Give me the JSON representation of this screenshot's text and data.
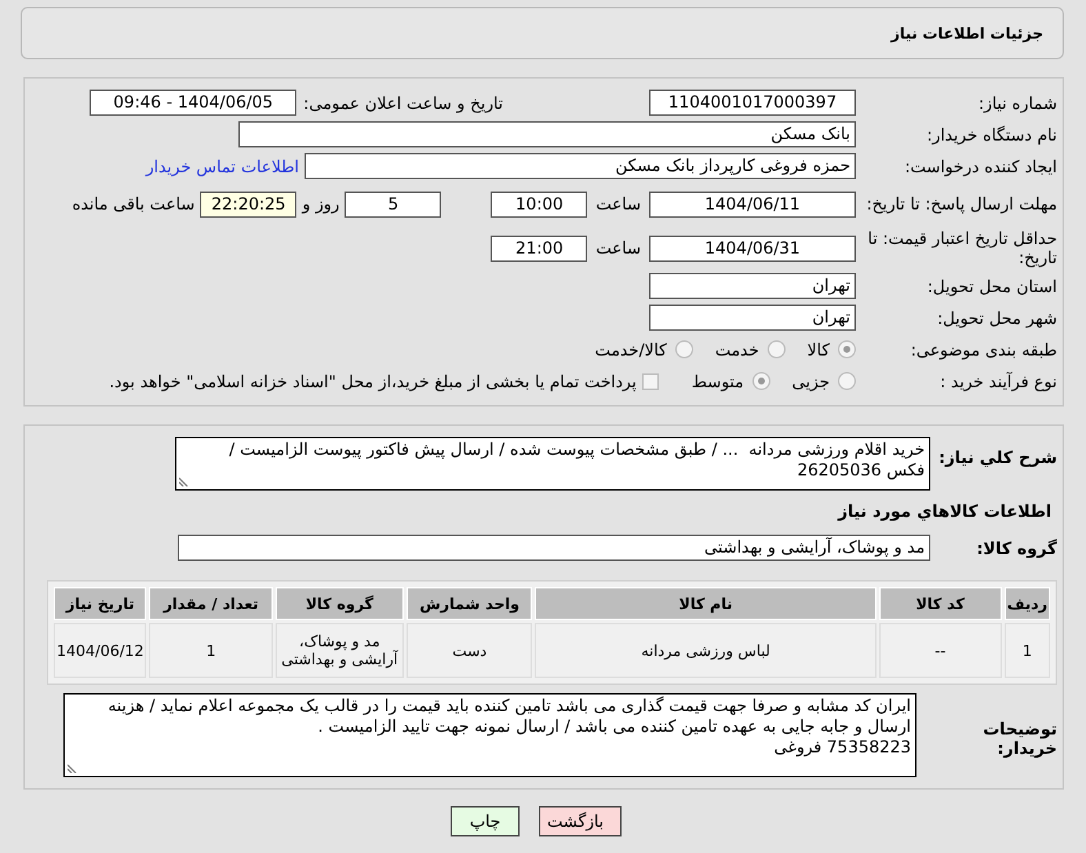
{
  "header": {
    "title": "جزئیات اطلاعات نیاز"
  },
  "need_number": {
    "label": "شماره نیاز:",
    "value": "1104001017000397"
  },
  "announce_date": {
    "label": "تاریخ و ساعت اعلان عمومی:",
    "value": "1404/06/05 - 09:46"
  },
  "buyer_org": {
    "label": "نام دستگاه خریدار:",
    "value": "بانک مسکن"
  },
  "requester": {
    "label": "ایجاد کننده درخواست:",
    "value": "حمزه فروغی کارپرداز بانک مسکن",
    "contact_link": "اطلاعات تماس خریدار"
  },
  "reply_deadline": {
    "label": "مهلت ارسال پاسخ: تا تاریخ:",
    "date": "1404/06/11",
    "time_label": "ساعت",
    "time": "10:00",
    "days": "5",
    "days_label": "روز و",
    "remaining": "22:20:25",
    "remaining_label": "ساعت باقی مانده"
  },
  "price_validity": {
    "label": "حداقل تاریخ اعتبار قیمت: تا تاریخ:",
    "date": "1404/06/31",
    "time_label": "ساعت",
    "time": "21:00"
  },
  "province": {
    "label": "استان محل تحویل:",
    "value": "تهران"
  },
  "city": {
    "label": "شهر محل تحویل:",
    "value": "تهران"
  },
  "category": {
    "label": "طبقه بندی موضوعی:",
    "options": [
      {
        "label": "کالا",
        "selected": true
      },
      {
        "label": "خدمت",
        "selected": false
      },
      {
        "label": "کالا/خدمت",
        "selected": false
      }
    ]
  },
  "process": {
    "label": "نوع فرآیند خرید :",
    "options": [
      {
        "label": "جزیی",
        "selected": false
      },
      {
        "label": "متوسط",
        "selected": true
      }
    ],
    "payment_note": {
      "text": "پرداخت تمام یا بخشی از مبلغ خرید،از محل \"اسناد خزانه اسلامی\" خواهد بود.",
      "checked": false
    }
  },
  "description": {
    "label": "شرح کلي نیاز:",
    "value": "خرید اقلام ورزشی مردانه  ... / طبق مشخصات پیوست شده / ارسال پیش فاکتور پیوست الزامیست / فکس 26205036"
  },
  "items_heading": "اطلاعات کالاهاي مورد نیاز",
  "goods_group": {
    "label": "گروه کالا:",
    "value": "مد و پوشاک، آرایشی و بهداشتی"
  },
  "table": {
    "columns": [
      "ردیف",
      "کد کالا",
      "نام کالا",
      "واحد شمارش",
      "گروه کالا",
      "تعداد / مقدار",
      "تاریخ نیاز"
    ],
    "rows": [
      [
        "1",
        "--",
        "لباس ورزشی مردانه",
        "دست",
        "مد و پوشاک، آرایشی و بهداشتی",
        "1",
        "1404/06/12"
      ]
    ]
  },
  "buyer_notes": {
    "label": "توضیحات خریدار:",
    "value": "ایران کد مشابه و صرفا جهت قیمت گذاری می باشد تامین کننده باید قیمت را در قالب یک مجموعه اعلام نماید / هزینه ارسال و جابه جایی به عهده تامین کننده می باشد / ارسال نمونه جهت تایید الزامیست .\n75358223 فروغی"
  },
  "buttons": [
    {
      "label": "بازگشت",
      "kind": "back"
    },
    {
      "label": "چاپ",
      "kind": "print"
    }
  ]
}
